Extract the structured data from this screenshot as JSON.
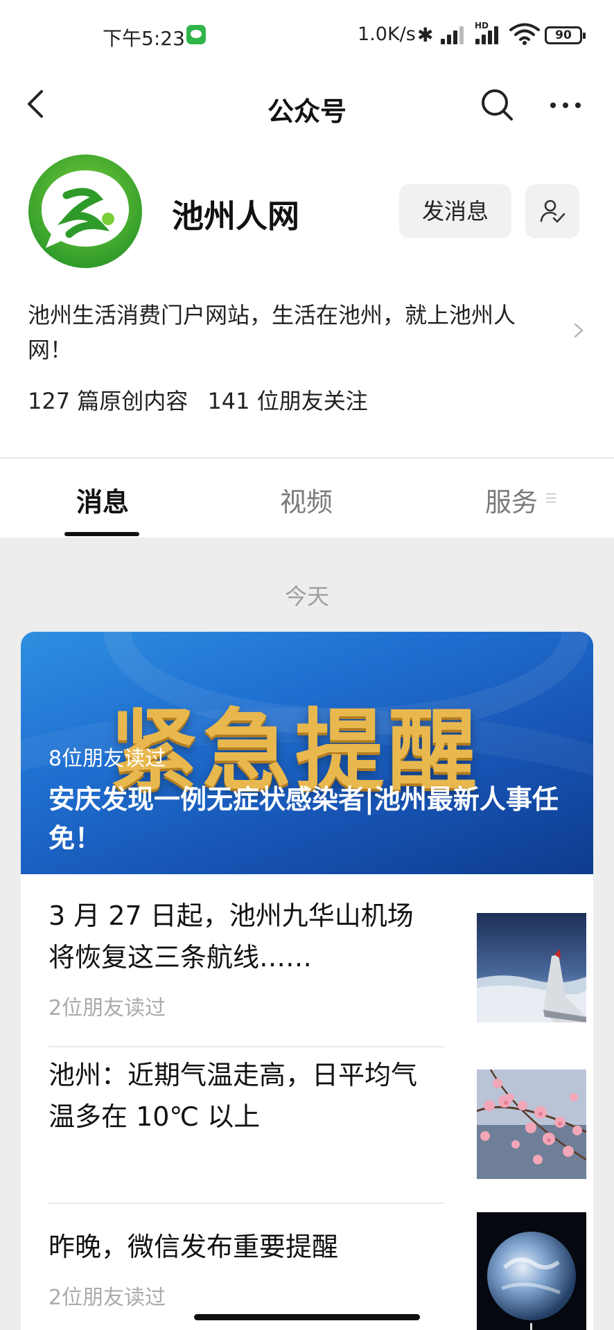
{
  "status_bar": {
    "time": "下午5:23",
    "network_speed": "1.0K/s",
    "bluetooth": "✱",
    "signal_hd": "HD",
    "battery": "90"
  },
  "nav": {
    "title": "公众号",
    "icons": [
      "back-icon",
      "search-icon",
      "more-icon"
    ]
  },
  "profile": {
    "name": "池州人网",
    "send_message_label": "发消息",
    "description": "池州生活消费门户网站，生活在池州，就上池州人网！",
    "stats": {
      "original_count": "127 篇原创内容",
      "followers": "141 位朋友关注"
    }
  },
  "tabs": [
    {
      "label": "消息",
      "active": true
    },
    {
      "label": "视频",
      "active": false
    },
    {
      "label": "服务",
      "active": false
    }
  ],
  "feed": {
    "date_label": "今天",
    "featured": {
      "banner_text": "紧急提醒",
      "reads": "8位朋友读过",
      "headline": "安庆发现一例无症状感染者|池州最新人事任免！"
    },
    "items": [
      {
        "title": "3 月 27 日起，池州九华山机场将恢复这三条航线……",
        "reads": "2位朋友读过",
        "thumb": "airplane-wing"
      },
      {
        "title": "池州：近期气温走高，日平均气温多在 10℃ 以上",
        "reads": "",
        "thumb": "pink-blossoms"
      },
      {
        "title": "昨晚，微信发布重要提醒",
        "reads": "2位朋友读过",
        "thumb": "earth"
      }
    ]
  },
  "colors": {
    "accent_green": "#2fb549",
    "banner_blue": "#1f6fd0",
    "banner_gold": "#e8b84f"
  }
}
